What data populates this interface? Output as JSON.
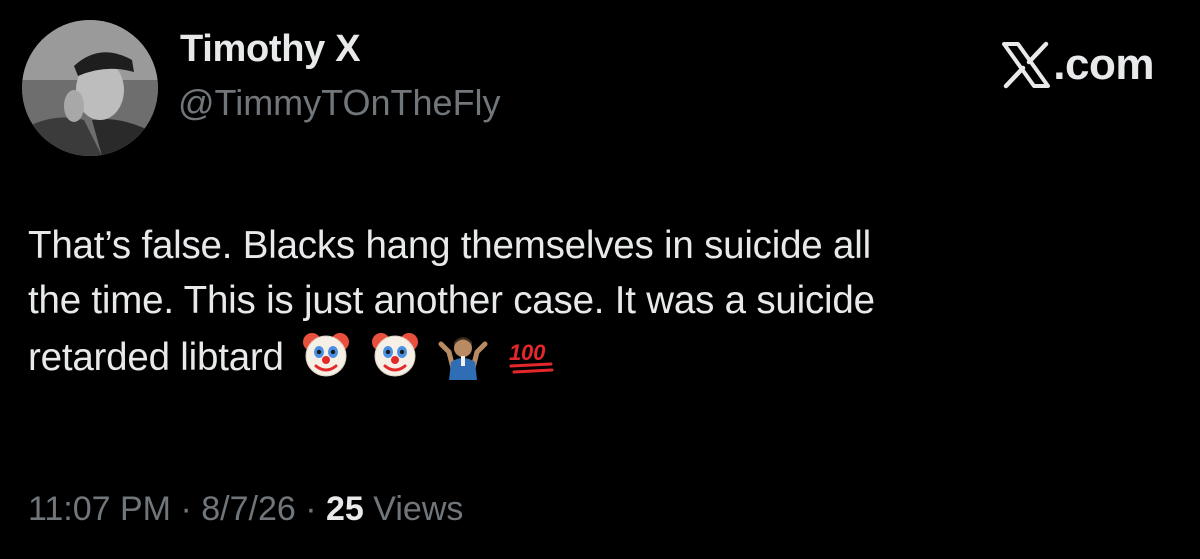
{
  "author": {
    "name": "Timothy X",
    "handle": "@TimmyTOnTheFly",
    "avatar_icon": "profile-photo"
  },
  "brand": {
    "icon": "x-logo-icon",
    "domain": ".com"
  },
  "tweet": {
    "lines": [
      "That’s false. Blacks hang themselves in suicide all",
      "the time. This is just another case. It was a suicide",
      "retarded libtard"
    ],
    "emojis": [
      "clown-face-emoji",
      "clown-face-emoji",
      "person-shrugging-emoji",
      "hundred-points-emoji"
    ]
  },
  "meta": {
    "time": "11:07 PM",
    "date": "8/7/26",
    "separator": "·",
    "views_count": "25",
    "views_label": "Views"
  }
}
